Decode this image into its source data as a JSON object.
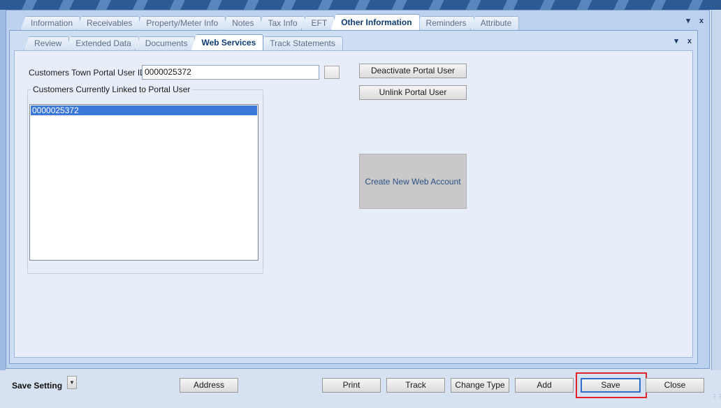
{
  "outer_tabs": [
    "Information",
    "Receivables",
    "Property/Meter Info",
    "Notes",
    "Tax Info",
    "EFT",
    "Other Information",
    "Reminders",
    "Attribute"
  ],
  "outer_active_tab": "Other Information",
  "inner_tabs": [
    "Review",
    "Extended Data",
    "Documents",
    "Web Services",
    "Track Statements"
  ],
  "inner_active_tab": "Web Services",
  "panel_controls": {
    "dropdown": "▾",
    "close": "x"
  },
  "web_services": {
    "portal_user_id_label": "Customers Town Portal User ID:",
    "portal_user_id_value": "0000025372",
    "linked_group_title": "Customers Currently Linked to Portal User",
    "linked_items": [
      "0000025372"
    ],
    "deactivate_label": "Deactivate Portal User",
    "unlink_label": "Unlink Portal User",
    "create_label": "Create New Web Account"
  },
  "bottom": {
    "save_setting_label": "Save Setting",
    "address_label": "Address",
    "print_label": "Print",
    "track_label": "Track",
    "change_type_label": "Change Type",
    "add_label": "Add",
    "save_label": "Save",
    "close_label": "Close"
  }
}
